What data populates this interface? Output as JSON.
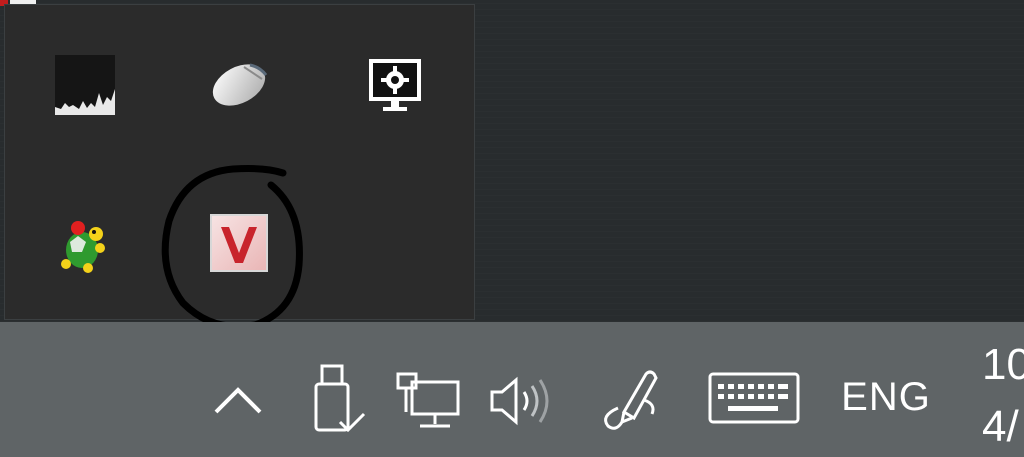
{
  "overflow_tray": {
    "icons": [
      {
        "name": "performance-graph-icon"
      },
      {
        "name": "mouse-icon"
      },
      {
        "name": "display-settings-icon"
      },
      {
        "name": "turtle-game-icon"
      },
      {
        "name": "v-app-icon"
      }
    ]
  },
  "taskbar": {
    "language": "ENG",
    "clock_time": "10",
    "clock_date": "4/"
  },
  "colors": {
    "annotation": "#000000",
    "v_icon_red": "#c8242c",
    "taskbar": "#5f6466"
  }
}
